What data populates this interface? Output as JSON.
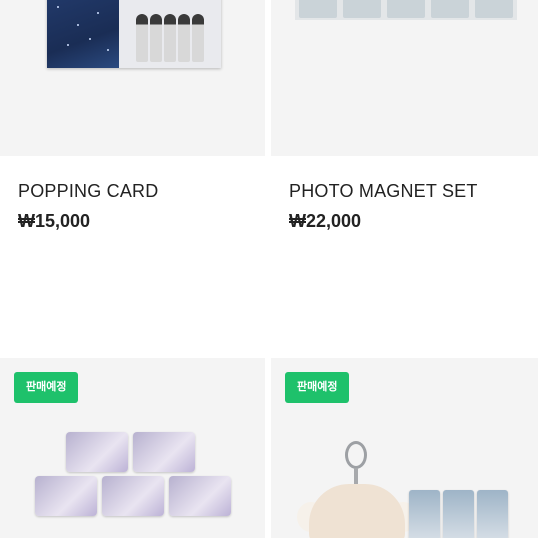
{
  "products": [
    {
      "title": "POPPING CARD",
      "price": "₩15,000"
    },
    {
      "title": "PHOTO MAGNET SET",
      "price": "₩22,000"
    },
    {
      "badge": "판매예정"
    },
    {
      "badge": "판매예정"
    }
  ]
}
